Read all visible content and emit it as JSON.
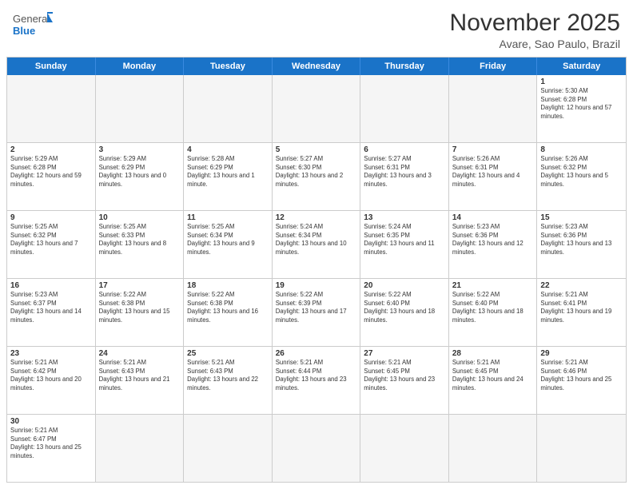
{
  "logo": {
    "text_general": "General",
    "text_blue": "Blue"
  },
  "header": {
    "title": "November 2025",
    "subtitle": "Avare, Sao Paulo, Brazil"
  },
  "weekdays": [
    "Sunday",
    "Monday",
    "Tuesday",
    "Wednesday",
    "Thursday",
    "Friday",
    "Saturday"
  ],
  "weeks": [
    [
      {
        "day": "",
        "info": "",
        "empty": true
      },
      {
        "day": "",
        "info": "",
        "empty": true
      },
      {
        "day": "",
        "info": "",
        "empty": true
      },
      {
        "day": "",
        "info": "",
        "empty": true
      },
      {
        "day": "",
        "info": "",
        "empty": true
      },
      {
        "day": "",
        "info": "",
        "empty": true
      },
      {
        "day": "1",
        "info": "Sunrise: 5:30 AM\nSunset: 6:28 PM\nDaylight: 12 hours and 57 minutes."
      }
    ],
    [
      {
        "day": "2",
        "info": "Sunrise: 5:29 AM\nSunset: 6:28 PM\nDaylight: 12 hours and 59 minutes."
      },
      {
        "day": "3",
        "info": "Sunrise: 5:29 AM\nSunset: 6:29 PM\nDaylight: 13 hours and 0 minutes."
      },
      {
        "day": "4",
        "info": "Sunrise: 5:28 AM\nSunset: 6:29 PM\nDaylight: 13 hours and 1 minute."
      },
      {
        "day": "5",
        "info": "Sunrise: 5:27 AM\nSunset: 6:30 PM\nDaylight: 13 hours and 2 minutes."
      },
      {
        "day": "6",
        "info": "Sunrise: 5:27 AM\nSunset: 6:31 PM\nDaylight: 13 hours and 3 minutes."
      },
      {
        "day": "7",
        "info": "Sunrise: 5:26 AM\nSunset: 6:31 PM\nDaylight: 13 hours and 4 minutes."
      },
      {
        "day": "8",
        "info": "Sunrise: 5:26 AM\nSunset: 6:32 PM\nDaylight: 13 hours and 5 minutes."
      }
    ],
    [
      {
        "day": "9",
        "info": "Sunrise: 5:25 AM\nSunset: 6:32 PM\nDaylight: 13 hours and 7 minutes."
      },
      {
        "day": "10",
        "info": "Sunrise: 5:25 AM\nSunset: 6:33 PM\nDaylight: 13 hours and 8 minutes."
      },
      {
        "day": "11",
        "info": "Sunrise: 5:25 AM\nSunset: 6:34 PM\nDaylight: 13 hours and 9 minutes."
      },
      {
        "day": "12",
        "info": "Sunrise: 5:24 AM\nSunset: 6:34 PM\nDaylight: 13 hours and 10 minutes."
      },
      {
        "day": "13",
        "info": "Sunrise: 5:24 AM\nSunset: 6:35 PM\nDaylight: 13 hours and 11 minutes."
      },
      {
        "day": "14",
        "info": "Sunrise: 5:23 AM\nSunset: 6:36 PM\nDaylight: 13 hours and 12 minutes."
      },
      {
        "day": "15",
        "info": "Sunrise: 5:23 AM\nSunset: 6:36 PM\nDaylight: 13 hours and 13 minutes."
      }
    ],
    [
      {
        "day": "16",
        "info": "Sunrise: 5:23 AM\nSunset: 6:37 PM\nDaylight: 13 hours and 14 minutes."
      },
      {
        "day": "17",
        "info": "Sunrise: 5:22 AM\nSunset: 6:38 PM\nDaylight: 13 hours and 15 minutes."
      },
      {
        "day": "18",
        "info": "Sunrise: 5:22 AM\nSunset: 6:38 PM\nDaylight: 13 hours and 16 minutes."
      },
      {
        "day": "19",
        "info": "Sunrise: 5:22 AM\nSunset: 6:39 PM\nDaylight: 13 hours and 17 minutes."
      },
      {
        "day": "20",
        "info": "Sunrise: 5:22 AM\nSunset: 6:40 PM\nDaylight: 13 hours and 18 minutes."
      },
      {
        "day": "21",
        "info": "Sunrise: 5:22 AM\nSunset: 6:40 PM\nDaylight: 13 hours and 18 minutes."
      },
      {
        "day": "22",
        "info": "Sunrise: 5:21 AM\nSunset: 6:41 PM\nDaylight: 13 hours and 19 minutes."
      }
    ],
    [
      {
        "day": "23",
        "info": "Sunrise: 5:21 AM\nSunset: 6:42 PM\nDaylight: 13 hours and 20 minutes."
      },
      {
        "day": "24",
        "info": "Sunrise: 5:21 AM\nSunset: 6:43 PM\nDaylight: 13 hours and 21 minutes."
      },
      {
        "day": "25",
        "info": "Sunrise: 5:21 AM\nSunset: 6:43 PM\nDaylight: 13 hours and 22 minutes."
      },
      {
        "day": "26",
        "info": "Sunrise: 5:21 AM\nSunset: 6:44 PM\nDaylight: 13 hours and 23 minutes."
      },
      {
        "day": "27",
        "info": "Sunrise: 5:21 AM\nSunset: 6:45 PM\nDaylight: 13 hours and 23 minutes."
      },
      {
        "day": "28",
        "info": "Sunrise: 5:21 AM\nSunset: 6:45 PM\nDaylight: 13 hours and 24 minutes."
      },
      {
        "day": "29",
        "info": "Sunrise: 5:21 AM\nSunset: 6:46 PM\nDaylight: 13 hours and 25 minutes."
      }
    ],
    [
      {
        "day": "30",
        "info": "Sunrise: 5:21 AM\nSunset: 6:47 PM\nDaylight: 13 hours and 25 minutes."
      },
      {
        "day": "",
        "info": "",
        "empty": true
      },
      {
        "day": "",
        "info": "",
        "empty": true
      },
      {
        "day": "",
        "info": "",
        "empty": true
      },
      {
        "day": "",
        "info": "",
        "empty": true
      },
      {
        "day": "",
        "info": "",
        "empty": true
      },
      {
        "day": "",
        "info": "",
        "empty": true
      }
    ]
  ]
}
